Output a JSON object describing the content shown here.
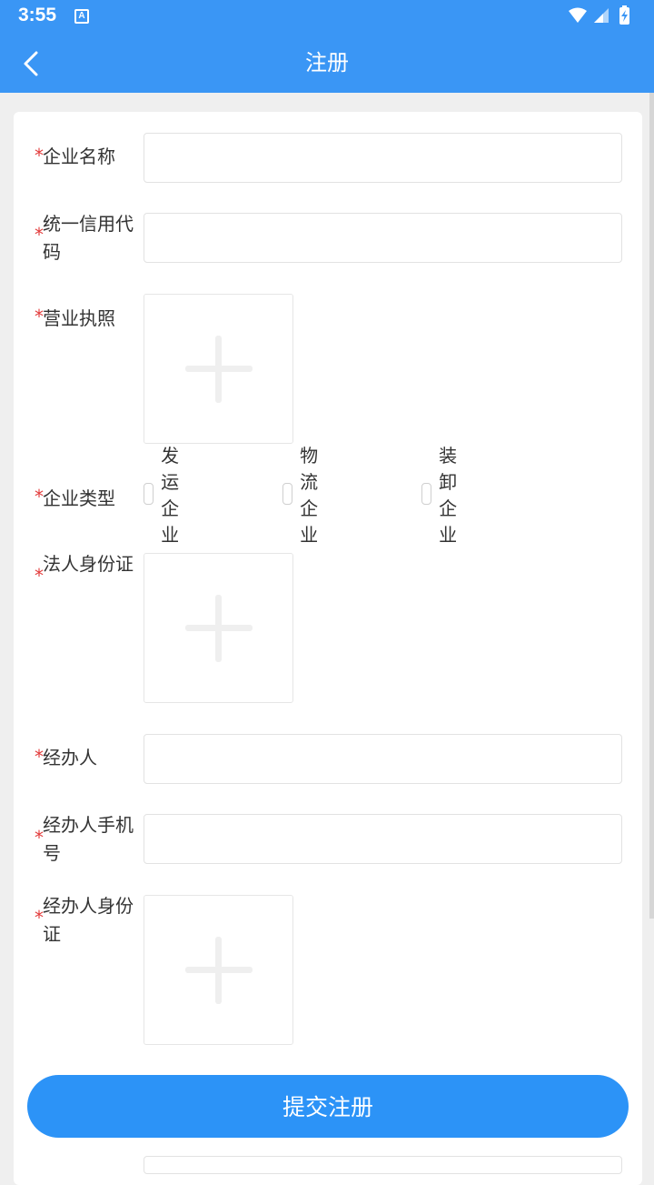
{
  "status_bar": {
    "time": "3:55",
    "notification_badge": "A",
    "icons": [
      "wifi-icon",
      "cellular-signal-icon",
      "battery-charging-icon"
    ]
  },
  "app_bar": {
    "title": "注册",
    "back_icon": "chevron-left-icon"
  },
  "form": {
    "company_name": {
      "label": "企业名称",
      "required": true,
      "value": "",
      "placeholder": ""
    },
    "credit_code": {
      "label": "统一信用代码",
      "required": true,
      "value": "",
      "placeholder": ""
    },
    "business_license": {
      "label": "营业执照",
      "required": true,
      "upload_icon": "plus-icon"
    },
    "company_type": {
      "label": "企业类型",
      "required": true,
      "options": [
        {
          "label": "发运企业",
          "checked": false
        },
        {
          "label": "物流企业",
          "checked": false
        },
        {
          "label": "装卸企业",
          "checked": false
        }
      ]
    },
    "legal_id": {
      "label": "法人身份证",
      "required": true,
      "upload_icon": "plus-icon"
    },
    "agent_name": {
      "label": "经办人",
      "required": true,
      "value": "",
      "placeholder": ""
    },
    "agent_phone": {
      "label": "经办人手机号",
      "required": true,
      "value": "",
      "placeholder": ""
    },
    "agent_id": {
      "label": "经办人身份证",
      "required": true,
      "upload_icon": "plus-icon"
    },
    "required_mark": "*"
  },
  "submit_label": "提交注册",
  "colors": {
    "brand": "#3a96f5",
    "button": "#2c93f7",
    "required": "#e23b3b",
    "background": "#efefef"
  }
}
